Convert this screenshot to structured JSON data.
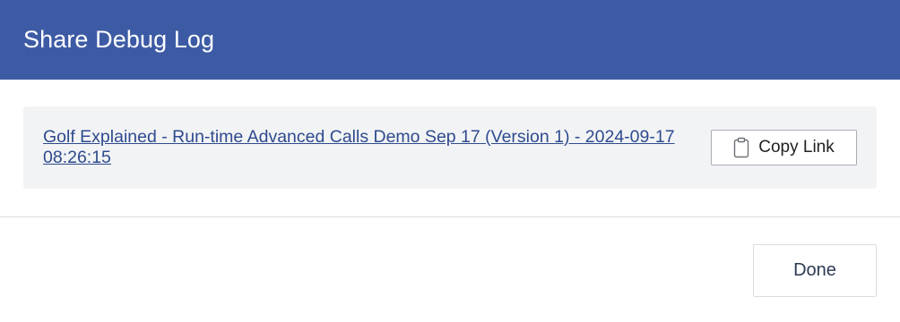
{
  "dialog": {
    "title": "Share Debug Log",
    "log_link_text": "Golf Explained - Run-time Advanced Calls Demo Sep 17 (Version 1) - 2024-09-17 08:26:15",
    "copy_link_label": "Copy Link",
    "copy_link_icon": "clipboard-icon",
    "done_label": "Done"
  },
  "colors": {
    "header_bg": "#3d5ba5",
    "link": "#2e4b8e",
    "panel_bg": "#f2f3f5"
  }
}
